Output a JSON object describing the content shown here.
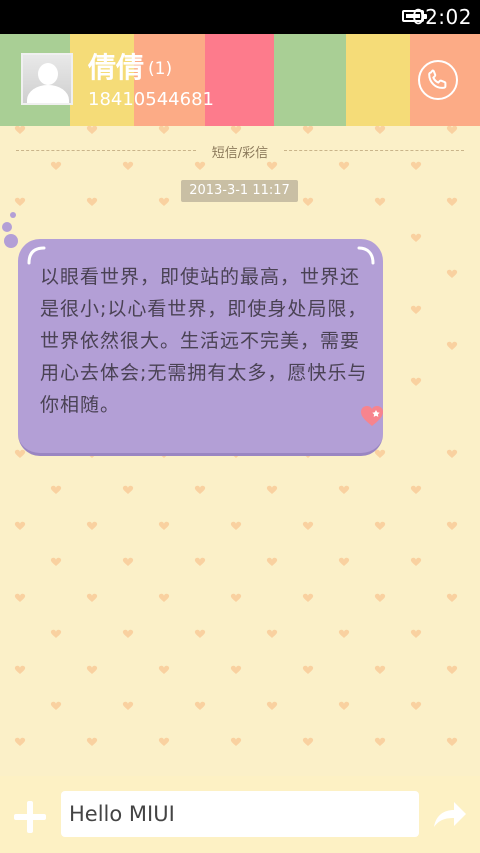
{
  "status_bar": {
    "time": "02:02"
  },
  "header": {
    "stripe_colors": [
      "#a9cf95",
      "#f5dc78",
      "#fcab86",
      "#fd7b8c",
      "#a9cf95",
      "#f5dc78",
      "#fcab86"
    ],
    "contact_name": "倩倩",
    "message_count": "(1)",
    "phone_number": "18410544681",
    "call_icon": "phone-icon"
  },
  "conversation": {
    "section_label": "短信/彩信",
    "timestamp": "2013-3-1 11:17",
    "message": "以眼看世界，即使站的最高，世界还是很小;以心看世界，即使身处局限，世界依然很大。生活远不完美，需要用心去体会;无需拥有太多，愿快乐与你相随。",
    "bubble_color": "#b39fd6"
  },
  "composer": {
    "add_icon": "plus-icon",
    "input_value": "Hello MIUI",
    "send_icon": "send-arrow-icon"
  }
}
